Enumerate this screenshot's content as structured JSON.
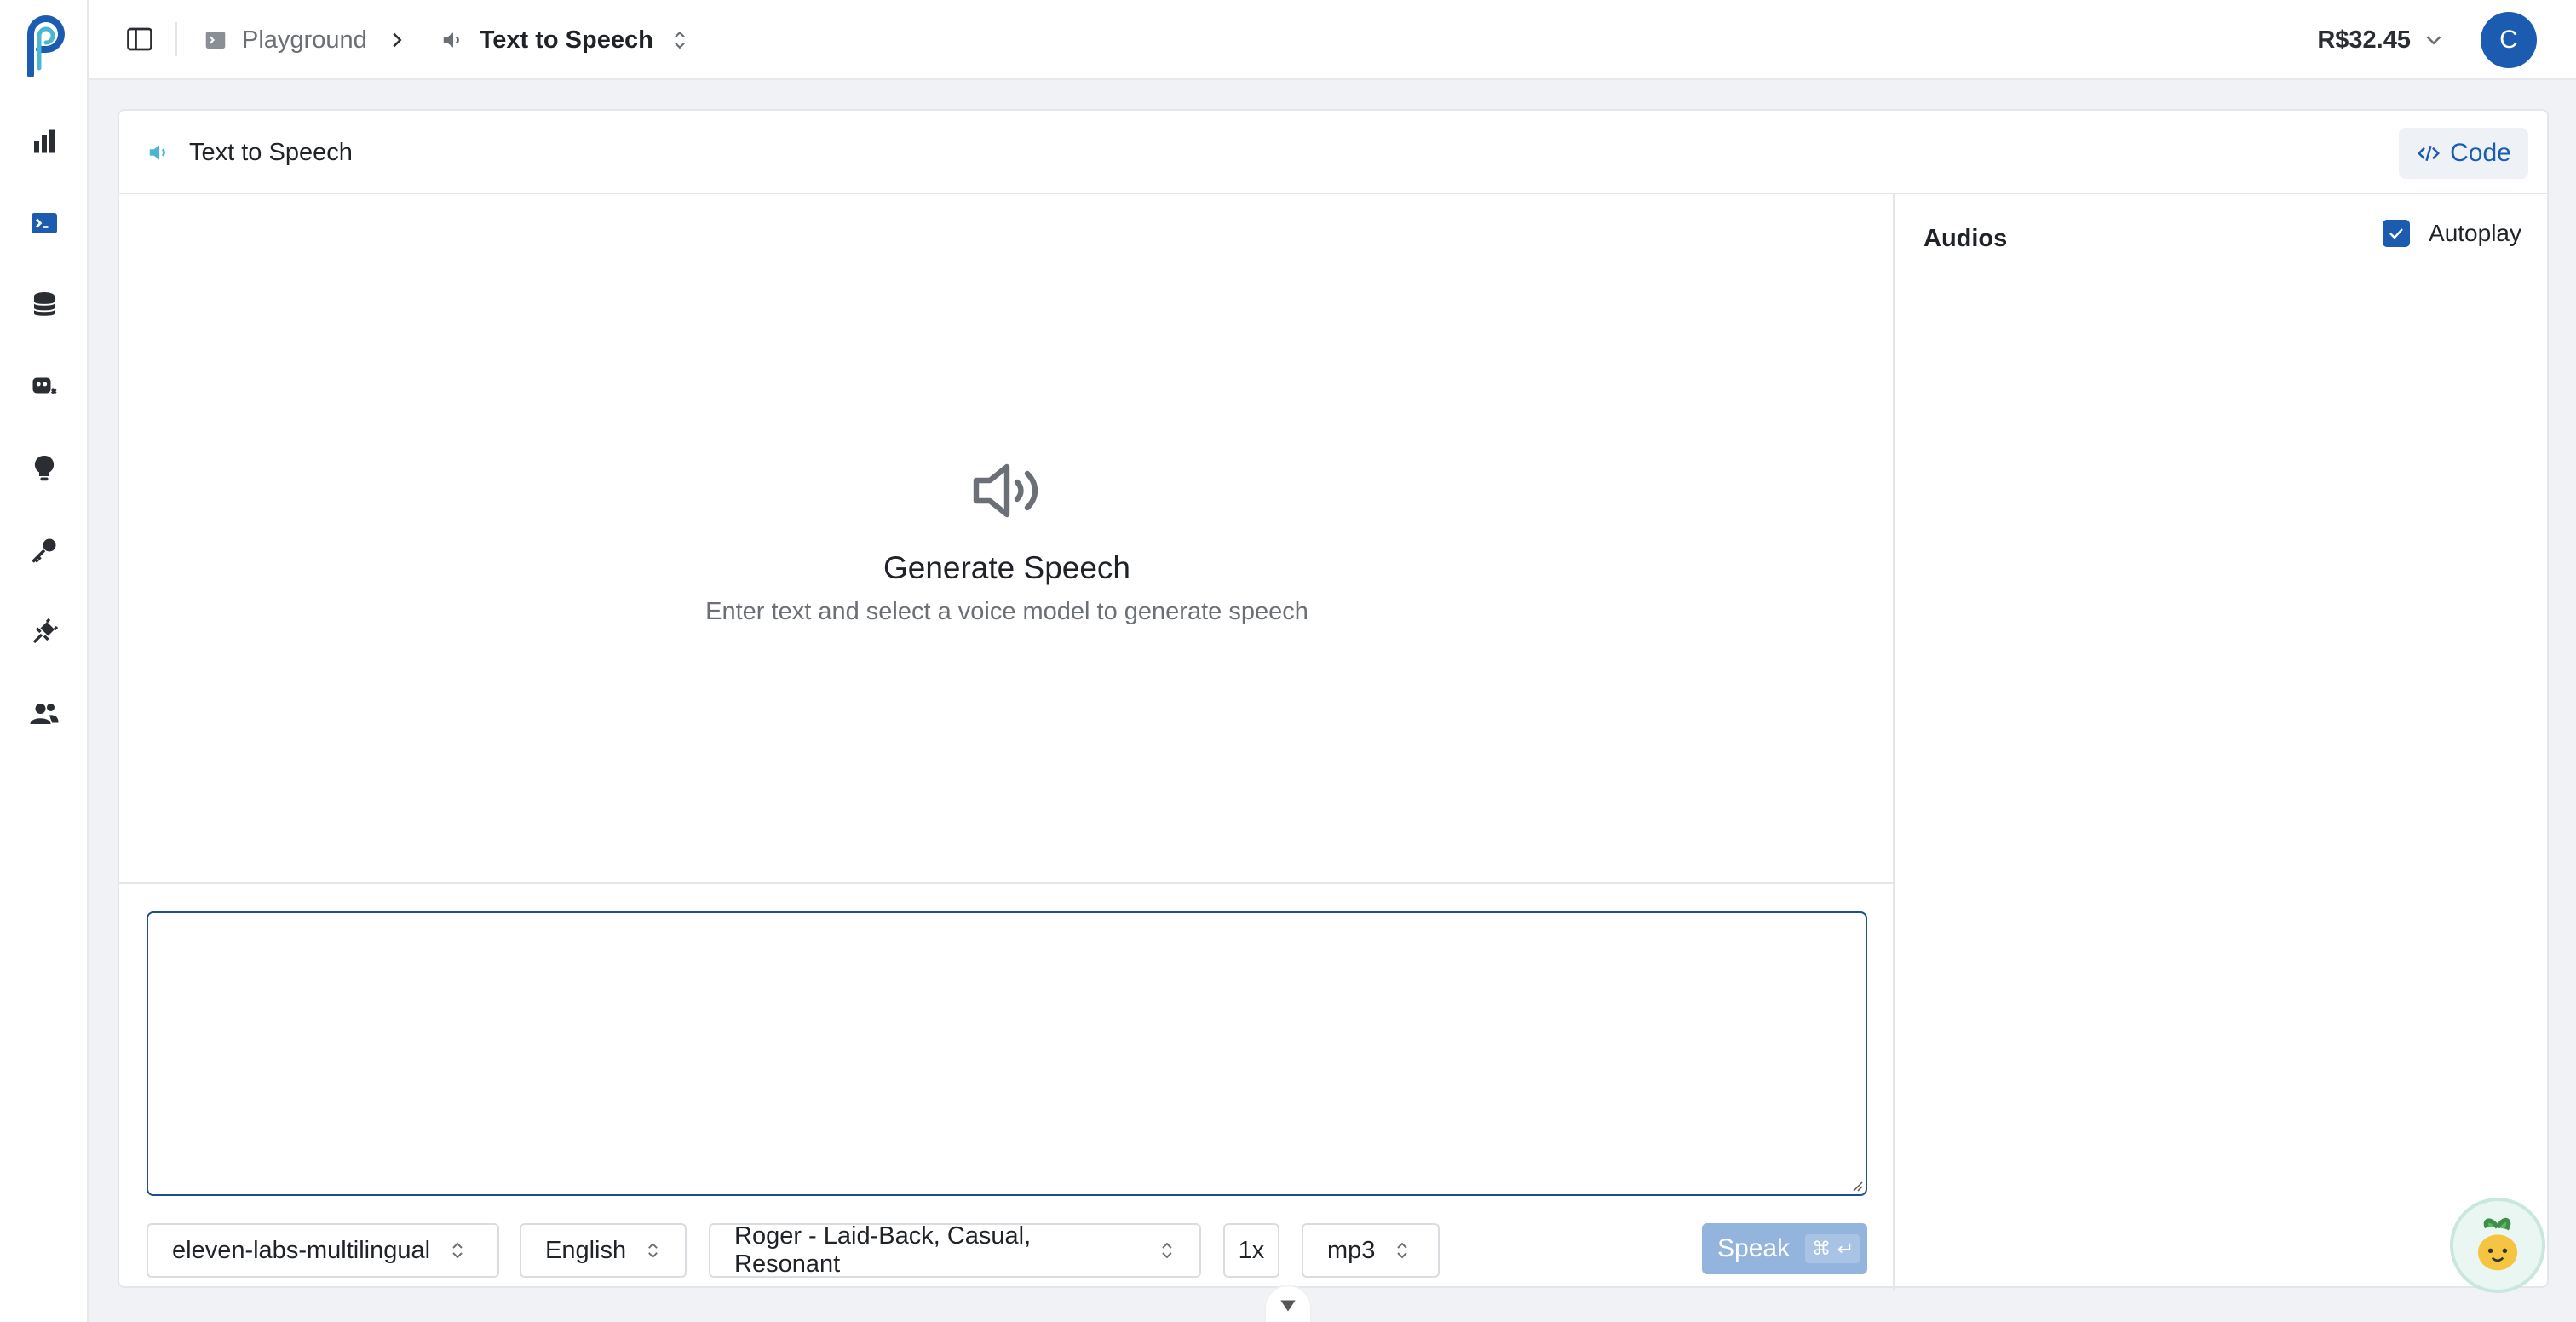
{
  "topbar": {
    "breadcrumb_root": "Playground",
    "breadcrumb_current": "Text to Speech",
    "balance": "R$32.45",
    "avatar_initial": "C"
  },
  "card": {
    "title": "Text to Speech",
    "code_label": "Code"
  },
  "empty_state": {
    "title": "Generate Speech",
    "subtitle": "Enter text and select a voice model to generate speech"
  },
  "composer": {
    "text_value": "",
    "model": "eleven-labs-multilingual",
    "language": "English",
    "voice": "Roger - Laid-Back, Casual, Resonant",
    "speed": "1x",
    "format": "mp3",
    "speak_label": "Speak",
    "shortcut": "⌘"
  },
  "audios": {
    "title": "Audios",
    "autoplay_label": "Autoplay",
    "autoplay_checked": true
  },
  "colors": {
    "accent": "#1b5cb0",
    "speak_disabled": "#92b4dd",
    "speaker_teal": "#4bb6d3"
  },
  "icons": {
    "sidebar": [
      "analytics-icon",
      "playground-terminal-icon",
      "database-icon",
      "models-icon",
      "ideas-bulb-icon",
      "api-key-icon",
      "integrations-plug-icon",
      "team-users-icon"
    ]
  }
}
